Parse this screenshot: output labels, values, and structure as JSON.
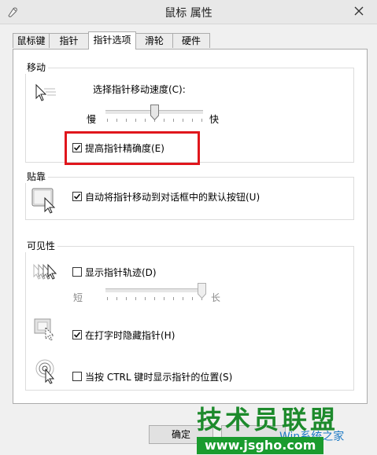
{
  "window": {
    "title": "鼠标 属性"
  },
  "tabs": [
    {
      "label": "鼠标键"
    },
    {
      "label": "指针"
    },
    {
      "label": "指针选项",
      "active": true
    },
    {
      "label": "滑轮"
    },
    {
      "label": "硬件"
    }
  ],
  "motion": {
    "group_label": "移动",
    "speed_label": "选择指针移动速度(C):",
    "slow_label": "慢",
    "fast_label": "快",
    "speed_value_fraction": 0.5,
    "precision_label": "提高指针精确度(E)",
    "precision_checked": true
  },
  "snap": {
    "group_label": "贴靠",
    "snap_label": "自动将指针移动到对话框中的默认按钮(U)",
    "snap_checked": true
  },
  "visibility": {
    "group_label": "可见性",
    "trails_label": "显示指针轨迹(D)",
    "trails_checked": false,
    "short_label": "短",
    "long_label": "长",
    "trail_length_fraction": 1.0,
    "hide_label": "在打字时隐藏指针(H)",
    "hide_checked": true,
    "ctrl_label": "当按 CTRL 键时显示指针的位置(S)",
    "ctrl_checked": false
  },
  "buttons": {
    "ok": "确定"
  },
  "watermark": {
    "brand": "技术员联盟",
    "url": "www.jsgho.com",
    "site": "Win系统之家"
  },
  "colors": {
    "highlight": "#e0161c",
    "watermark_green": "#1d8a2c"
  }
}
